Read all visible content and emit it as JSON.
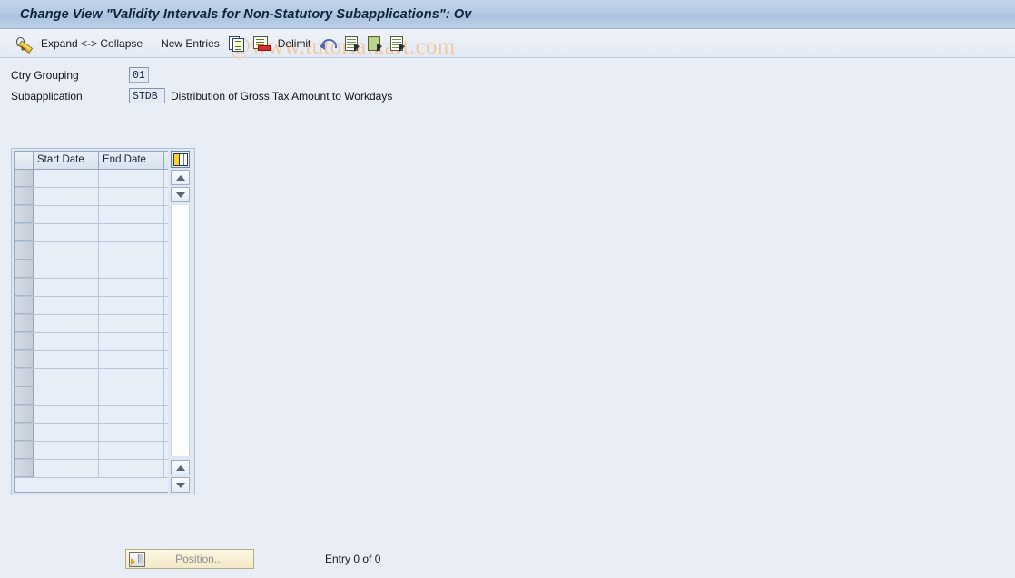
{
  "window": {
    "title": "Change View \"Validity Intervals for Non-Statutory Subapplications\": Ov"
  },
  "toolbar": {
    "edit_icon": "pencil-icon",
    "expand_collapse_label": "Expand <-> Collapse",
    "new_entries_label": "New Entries",
    "copy_icon": "copy-icon",
    "delete_icon": "delete-row-icon",
    "delimit_label": "Delimit",
    "undo_icon": "undo-icon",
    "select_all_icon": "select-all-icon",
    "select_block_icon": "select-block-icon",
    "deselect_icon": "deselect-all-icon"
  },
  "watermark": {
    "text": "@www.tutorialkart.com",
    "color": "#f0c9a0"
  },
  "form": {
    "fields": [
      {
        "label": "Ctry Grouping",
        "value": "01",
        "description": ""
      },
      {
        "label": "Subapplication",
        "value": "STDB",
        "description": "Distribution of Gross Tax Amount to Workdays"
      }
    ]
  },
  "table": {
    "columns": [
      "Start Date",
      "End Date"
    ],
    "config_icon": "column-config-icon",
    "rows": [],
    "row_count_rendered": 17,
    "scroll_up_icon": "scroll-up-arrow-icon",
    "scroll_down_icon": "scroll-down-arrow-icon"
  },
  "footer": {
    "position_button_label": "Position...",
    "position_button_icon": "position-icon",
    "entry_status": "Entry 0 of 0"
  },
  "colors": {
    "page_background": "#e9eef6",
    "titlebar": "#b3c9e3",
    "grid_cell": "#e8eef7",
    "button_yellow": "#f2e9c8"
  }
}
